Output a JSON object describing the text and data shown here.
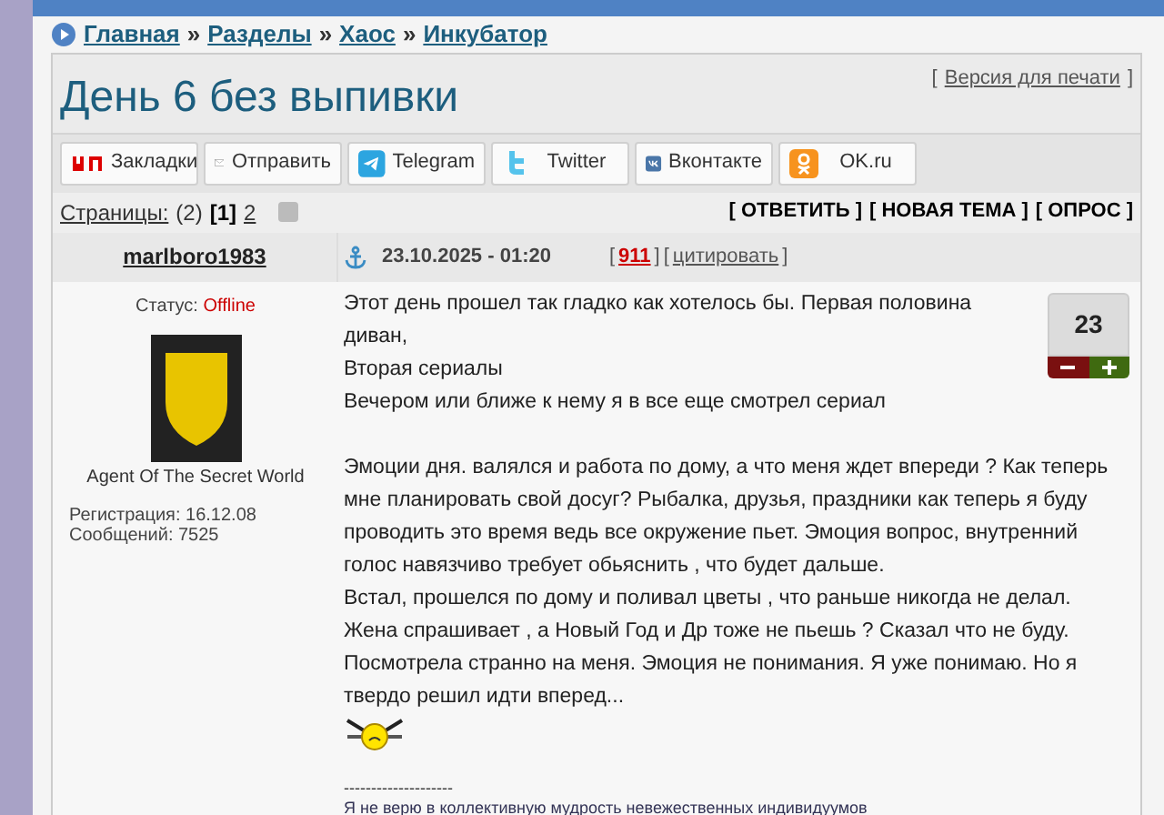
{
  "breadcrumbs": [
    "Главная",
    "Разделы",
    "Хаос",
    "Инкубатор"
  ],
  "breadcrumb_separator": "»",
  "brackets": [
    "[",
    "]"
  ],
  "title": "День 6 без выпивки",
  "print_link": "Версия для печати",
  "share_buttons": [
    {
      "label": "Закладки",
      "kind": "yp"
    },
    {
      "label": "Отправить",
      "kind": "mail"
    },
    {
      "label": "Telegram",
      "kind": "telegram"
    },
    {
      "label": "Twitter",
      "kind": "twitter"
    },
    {
      "label": "Вконтакте",
      "kind": "vk"
    },
    {
      "label": "OK.ru",
      "kind": "ok"
    }
  ],
  "pagination": {
    "label": "Страницы:",
    "count": "(2)",
    "pages": [
      {
        "label": "[1]",
        "selected": true
      },
      {
        "label": "2",
        "selected": false
      }
    ]
  },
  "actions": [
    "[ ОТВЕТИТЬ ]",
    "[ НОВАЯ ТЕМА ]",
    "[ ОПРОС ]"
  ],
  "post": {
    "author": "marlboro1983",
    "date": "23.10.2025 - 01:20",
    "number": "911",
    "quote_link": "цитировать",
    "status_label": "Статус:",
    "status": "Offline",
    "user_title": "Agent Of The Secret World",
    "registration": "Регистрация: 16.12.08",
    "messages": "Сообщений: 7525",
    "rating": "23",
    "body": [
      "Этот день прошел так гладко как хотелось бы. Первая половина диван,\nВторая сериалы\nВечером или ближе к нему я в все еще смотрел сериал",
      "Эмоции дня. валялся и работа по дому, а что меня ждет впереди ? Как теперь мне планировать свой досуг? Рыбалка, друзья, праздники как теперь я буду проводить это время ведь все окружение пьет. Эмоция вопрос, внутренний голос навязчиво требует обьяснить , что будет дальше.\nВстал, прошелся по дому и поливал цветы , что раньше никогда не делал. Жена спрашивает , а Новый Год и Др тоже не пьешь ? Сказал что не буду. Посмотрела странно на меня. Эмоция не понимания. Я уже понимаю. Но я твердо решил идти вперед..."
    ],
    "divider": "--------------------",
    "signature": "Я не верю в коллективную мудрость невежественных индивидуумов"
  }
}
